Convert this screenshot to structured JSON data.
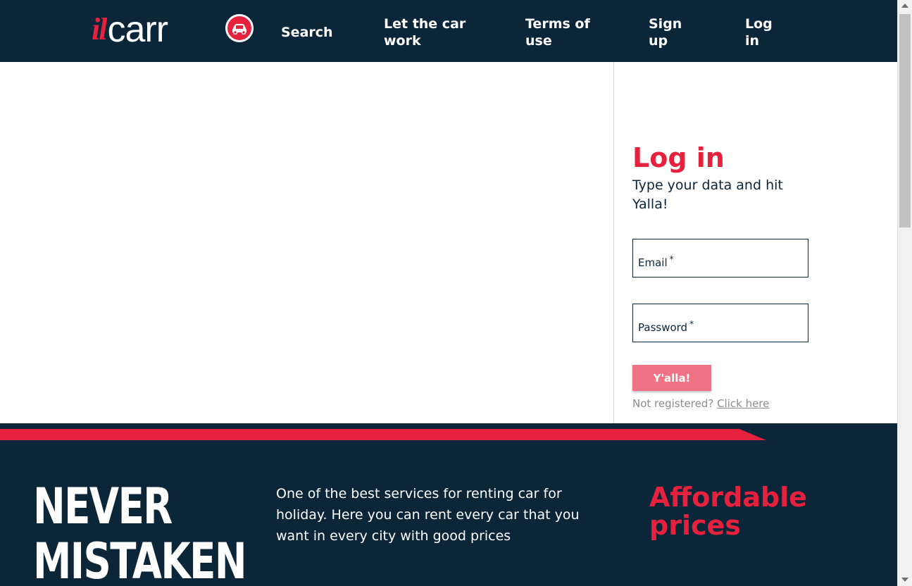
{
  "header": {
    "logo": {
      "il": "il",
      "carr": "carr"
    },
    "nav": {
      "search": "Search",
      "let_car_work_1": "Let the car",
      "let_car_work_2": "work",
      "terms_1": "Terms of",
      "terms_2": "use",
      "signup_1": "Sign",
      "signup_2": "up",
      "login_1": "Log",
      "login_2": "in"
    }
  },
  "login_panel": {
    "title": "Log in",
    "subtitle": "Type your data and hit Yalla!",
    "email_label": "Email",
    "password_label": "Password",
    "required_mark": "*",
    "submit_label": "Y'alla!",
    "not_registered": "Not registered?",
    "click_here": "Click here"
  },
  "footer": {
    "slogan_1": "NEVER",
    "slogan_2": "MISTAKEN",
    "description": "One of the best services for renting car for holiday. Here you can rent every car that you want in every city with good prices",
    "title": "Affordable prices"
  },
  "colors": {
    "navy": "#0b2539",
    "brand_red": "#e5213e",
    "button_pink": "#f07385"
  },
  "icons": [
    "car-icon",
    "scroll-up-arrow-icon",
    "scroll-down-arrow-icon"
  ]
}
